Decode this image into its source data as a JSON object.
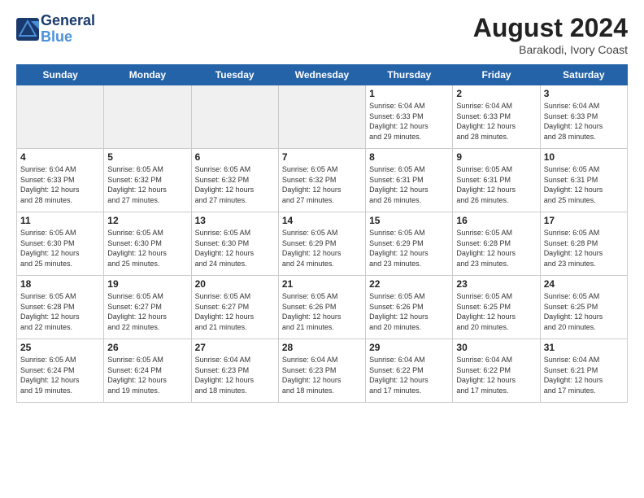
{
  "header": {
    "logo_line1": "General",
    "logo_line2": "Blue",
    "month": "August 2024",
    "location": "Barakodi, Ivory Coast"
  },
  "weekdays": [
    "Sunday",
    "Monday",
    "Tuesday",
    "Wednesday",
    "Thursday",
    "Friday",
    "Saturday"
  ],
  "weeks": [
    [
      {
        "day": "",
        "empty": true
      },
      {
        "day": "",
        "empty": true
      },
      {
        "day": "",
        "empty": true
      },
      {
        "day": "",
        "empty": true
      },
      {
        "day": "1",
        "info": "Sunrise: 6:04 AM\nSunset: 6:33 PM\nDaylight: 12 hours\nand 29 minutes."
      },
      {
        "day": "2",
        "info": "Sunrise: 6:04 AM\nSunset: 6:33 PM\nDaylight: 12 hours\nand 28 minutes."
      },
      {
        "day": "3",
        "info": "Sunrise: 6:04 AM\nSunset: 6:33 PM\nDaylight: 12 hours\nand 28 minutes."
      }
    ],
    [
      {
        "day": "4",
        "info": "Sunrise: 6:04 AM\nSunset: 6:33 PM\nDaylight: 12 hours\nand 28 minutes."
      },
      {
        "day": "5",
        "info": "Sunrise: 6:05 AM\nSunset: 6:32 PM\nDaylight: 12 hours\nand 27 minutes."
      },
      {
        "day": "6",
        "info": "Sunrise: 6:05 AM\nSunset: 6:32 PM\nDaylight: 12 hours\nand 27 minutes."
      },
      {
        "day": "7",
        "info": "Sunrise: 6:05 AM\nSunset: 6:32 PM\nDaylight: 12 hours\nand 27 minutes."
      },
      {
        "day": "8",
        "info": "Sunrise: 6:05 AM\nSunset: 6:31 PM\nDaylight: 12 hours\nand 26 minutes."
      },
      {
        "day": "9",
        "info": "Sunrise: 6:05 AM\nSunset: 6:31 PM\nDaylight: 12 hours\nand 26 minutes."
      },
      {
        "day": "10",
        "info": "Sunrise: 6:05 AM\nSunset: 6:31 PM\nDaylight: 12 hours\nand 25 minutes."
      }
    ],
    [
      {
        "day": "11",
        "info": "Sunrise: 6:05 AM\nSunset: 6:30 PM\nDaylight: 12 hours\nand 25 minutes."
      },
      {
        "day": "12",
        "info": "Sunrise: 6:05 AM\nSunset: 6:30 PM\nDaylight: 12 hours\nand 25 minutes."
      },
      {
        "day": "13",
        "info": "Sunrise: 6:05 AM\nSunset: 6:30 PM\nDaylight: 12 hours\nand 24 minutes."
      },
      {
        "day": "14",
        "info": "Sunrise: 6:05 AM\nSunset: 6:29 PM\nDaylight: 12 hours\nand 24 minutes."
      },
      {
        "day": "15",
        "info": "Sunrise: 6:05 AM\nSunset: 6:29 PM\nDaylight: 12 hours\nand 23 minutes."
      },
      {
        "day": "16",
        "info": "Sunrise: 6:05 AM\nSunset: 6:28 PM\nDaylight: 12 hours\nand 23 minutes."
      },
      {
        "day": "17",
        "info": "Sunrise: 6:05 AM\nSunset: 6:28 PM\nDaylight: 12 hours\nand 23 minutes."
      }
    ],
    [
      {
        "day": "18",
        "info": "Sunrise: 6:05 AM\nSunset: 6:28 PM\nDaylight: 12 hours\nand 22 minutes."
      },
      {
        "day": "19",
        "info": "Sunrise: 6:05 AM\nSunset: 6:27 PM\nDaylight: 12 hours\nand 22 minutes."
      },
      {
        "day": "20",
        "info": "Sunrise: 6:05 AM\nSunset: 6:27 PM\nDaylight: 12 hours\nand 21 minutes."
      },
      {
        "day": "21",
        "info": "Sunrise: 6:05 AM\nSunset: 6:26 PM\nDaylight: 12 hours\nand 21 minutes."
      },
      {
        "day": "22",
        "info": "Sunrise: 6:05 AM\nSunset: 6:26 PM\nDaylight: 12 hours\nand 20 minutes."
      },
      {
        "day": "23",
        "info": "Sunrise: 6:05 AM\nSunset: 6:25 PM\nDaylight: 12 hours\nand 20 minutes."
      },
      {
        "day": "24",
        "info": "Sunrise: 6:05 AM\nSunset: 6:25 PM\nDaylight: 12 hours\nand 20 minutes."
      }
    ],
    [
      {
        "day": "25",
        "info": "Sunrise: 6:05 AM\nSunset: 6:24 PM\nDaylight: 12 hours\nand 19 minutes."
      },
      {
        "day": "26",
        "info": "Sunrise: 6:05 AM\nSunset: 6:24 PM\nDaylight: 12 hours\nand 19 minutes."
      },
      {
        "day": "27",
        "info": "Sunrise: 6:04 AM\nSunset: 6:23 PM\nDaylight: 12 hours\nand 18 minutes."
      },
      {
        "day": "28",
        "info": "Sunrise: 6:04 AM\nSunset: 6:23 PM\nDaylight: 12 hours\nand 18 minutes."
      },
      {
        "day": "29",
        "info": "Sunrise: 6:04 AM\nSunset: 6:22 PM\nDaylight: 12 hours\nand 17 minutes."
      },
      {
        "day": "30",
        "info": "Sunrise: 6:04 AM\nSunset: 6:22 PM\nDaylight: 12 hours\nand 17 minutes."
      },
      {
        "day": "31",
        "info": "Sunrise: 6:04 AM\nSunset: 6:21 PM\nDaylight: 12 hours\nand 17 minutes."
      }
    ]
  ]
}
